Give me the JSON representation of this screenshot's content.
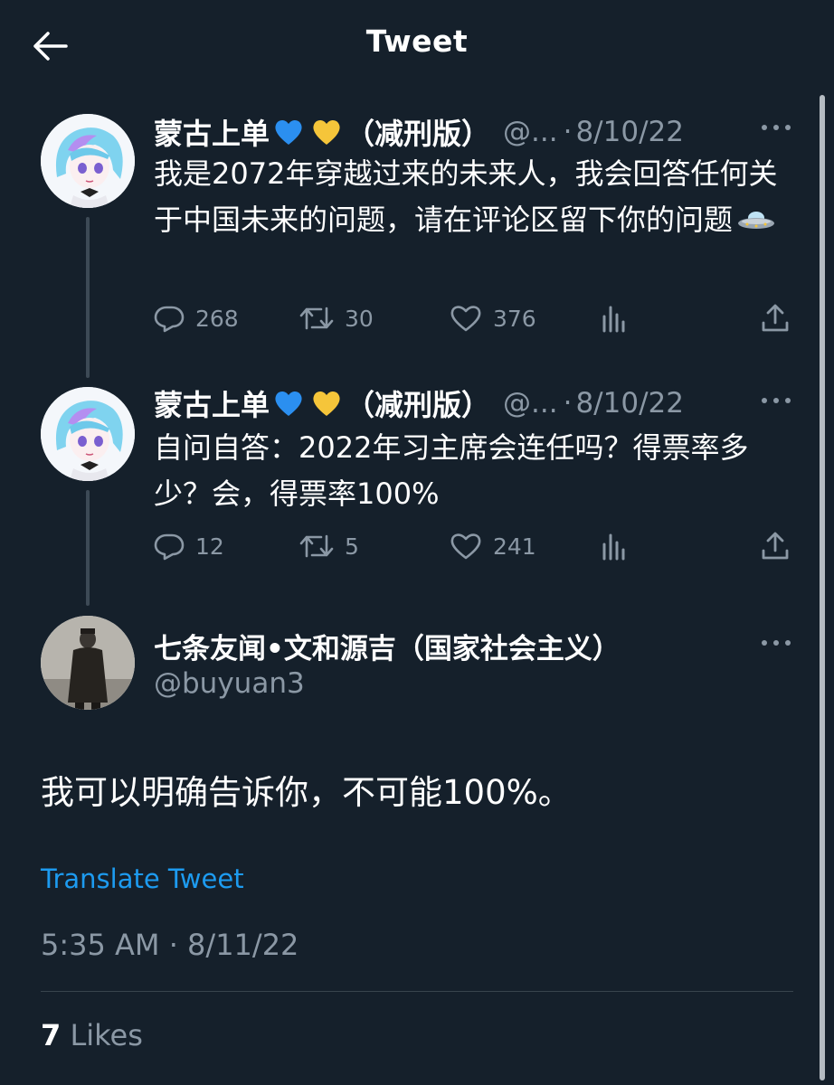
{
  "header": {
    "title": "Tweet"
  },
  "tweets": [
    {
      "display_name": "蒙古上单",
      "emoji_1": "blue-heart-icon",
      "emoji_2": "yellow-heart-icon",
      "name_suffix": "（减刑版）",
      "handle": "@...",
      "separator": "·",
      "date": "8/10/22",
      "text": "我是2072年穿越过来的未来人，我会回答任何关于中国未来的问题，请在评论区留下你的问题",
      "trailing_emoji": "ufo-icon",
      "replies": "268",
      "retweets": "30",
      "likes": "376"
    },
    {
      "display_name": "蒙古上单",
      "emoji_1": "blue-heart-icon",
      "emoji_2": "yellow-heart-icon",
      "name_suffix": "（减刑版）",
      "handle": "@...",
      "separator": "·",
      "date": "8/10/22",
      "text": "自问自答：2022年习主席会连任吗？得票率多少？会，得票率100%",
      "replies": "12",
      "retweets": "5",
      "likes": "241"
    }
  ],
  "main": {
    "display_name": "七条友闻•文和源吉（国家社会主义）",
    "handle": "@buyuan3",
    "text": "我可以明确告诉你，不可能100%。",
    "translate_label": "Translate Tweet",
    "timestamp": "5:35 AM · 8/11/22",
    "likes_count": "7",
    "likes_label": "Likes"
  },
  "colors": {
    "background": "#15202b",
    "secondary_text": "#8b98a5",
    "link": "#1d9bf0",
    "divider": "#38444d"
  }
}
